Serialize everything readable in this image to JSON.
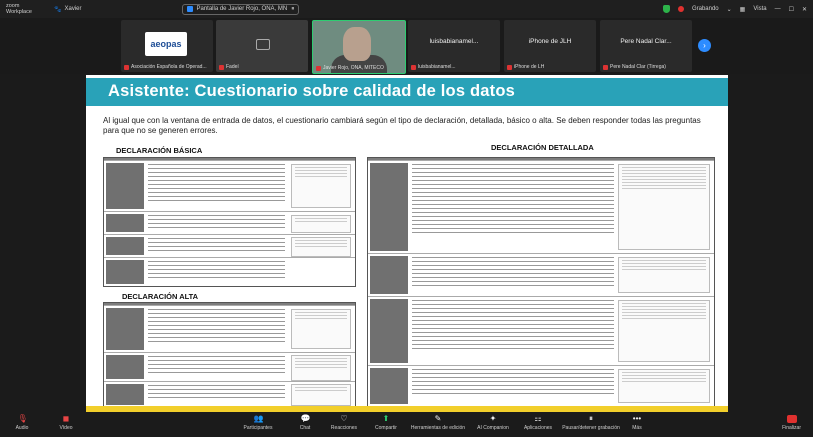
{
  "topbar": {
    "brand_line1": "zoom",
    "brand_line2": "Workplace",
    "participant_name": "Xavier",
    "share_label": "Pantalla de Javier Rojo, ONA, MN",
    "recording_label": "Grabando",
    "view_label": "Vista"
  },
  "gallery": {
    "tiles": [
      {
        "name": "Asociación Española de Operad...",
        "center": "aeopas"
      },
      {
        "name": "Fadeí",
        "center": ""
      },
      {
        "name": "Javier Rojo, ONA, MITECO",
        "center": ""
      },
      {
        "name": "luisbabianamel...",
        "center": "luisbabianamel..."
      },
      {
        "name": "iPhone de LH",
        "center": "iPhone de JLH"
      },
      {
        "name": "Pere Nadal Clar (Tirrega)",
        "center": "Pere Nadal Clar..."
      }
    ]
  },
  "slide": {
    "title": "Asistente: Cuestionario sobre calidad de los datos",
    "intro": "Al igual que con la ventana de entrada de datos, el cuestionario cambiará según el tipo de declaración, detallada, básico o alta. Se deben responder todas las preguntas para que no se generen errores.",
    "basic_title": "DECLARACIÓN BÁSICA",
    "alta_title": "DECLARACIÓN ALTA",
    "detailed_title": "DECLARACIÓN DETALLADA"
  },
  "toolbar": {
    "items": [
      {
        "label": "Audio",
        "icon": "mic-icon"
      },
      {
        "label": "Vídeo",
        "icon": "video-icon"
      },
      {
        "label": "Participantes",
        "icon": "participants-icon"
      },
      {
        "label": "Chat",
        "icon": "chat-icon"
      },
      {
        "label": "Reacciones",
        "icon": "reactions-icon"
      },
      {
        "label": "Compartir",
        "icon": "share-icon"
      },
      {
        "label": "Herramientas de edición",
        "icon": "edit-icon"
      },
      {
        "label": "AI Companion",
        "icon": "ai-icon"
      },
      {
        "label": "Aplicaciones",
        "icon": "apps-icon"
      },
      {
        "label": "Pausar/detener grabación",
        "icon": "pause-icon"
      },
      {
        "label": "Más",
        "icon": "more-icon"
      }
    ],
    "end_label": "Finalizar"
  }
}
